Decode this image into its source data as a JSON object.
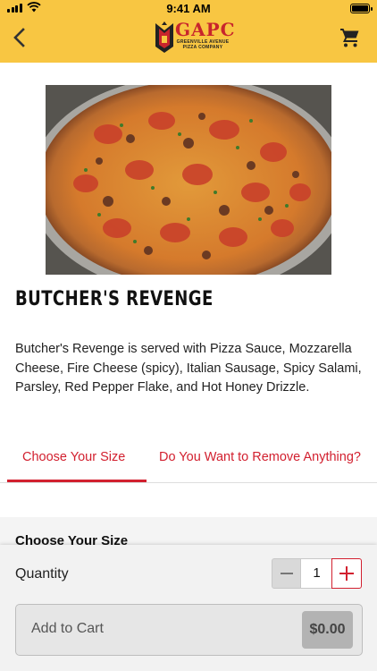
{
  "status_bar": {
    "time": "9:41 AM"
  },
  "header": {
    "logo_text": "GAPC",
    "logo_subtitle": "GREENVILLE AVENUE PIZZA COMPANY",
    "back_icon": "chevron-left-icon",
    "cart_icon": "cart-icon",
    "bar_color": "#f8c642"
  },
  "product": {
    "title": "BUTCHER'S REVENGE",
    "description": "Butcher's Revenge is served with Pizza Sauce, Mozzarella Cheese, Fire Cheese (spicy), Italian Sausage, Spicy Salami, Parsley, Red Pepper Flake, and Hot Honey Drizzle."
  },
  "tabs": [
    {
      "label": "Choose Your Size",
      "active": true
    },
    {
      "label": "Do You Want to Remove Anything?",
      "active": false
    }
  ],
  "section": {
    "heading": "Choose Your Size"
  },
  "bottom_sheet": {
    "quantity_label": "Quantity",
    "quantity_value": "1",
    "add_to_cart_label": "Add to Cart",
    "price": "$0.00"
  },
  "colors": {
    "accent": "#d2202f",
    "header": "#f8c642"
  }
}
